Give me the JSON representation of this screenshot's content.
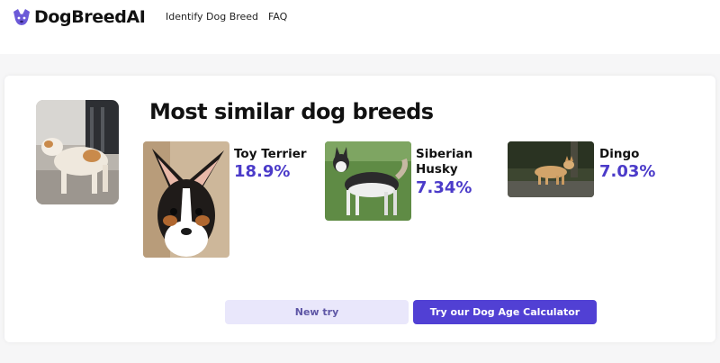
{
  "brand": {
    "name": "DogBreedAI",
    "accent": "#4b3bc9"
  },
  "nav": {
    "items": [
      "Identify Dog Breed",
      "FAQ"
    ]
  },
  "results": {
    "title": "Most similar dog breeds",
    "breeds": [
      {
        "name": "Toy Terrier",
        "percent": "18.9%",
        "photo": "toy-terrier-photo"
      },
      {
        "name": "Siberian Husky",
        "percent": "7.34%",
        "photo": "siberian-husky-photo"
      },
      {
        "name": "Dingo",
        "percent": "7.03%",
        "photo": "dingo-photo"
      }
    ],
    "uploaded_photo": "uploaded-dog-photo"
  },
  "actions": {
    "new_try": "New try",
    "age_calculator": "Try our Dog Age Calculator",
    "primary_color": "#5140d4",
    "secondary_color": "#e9e7fb"
  }
}
